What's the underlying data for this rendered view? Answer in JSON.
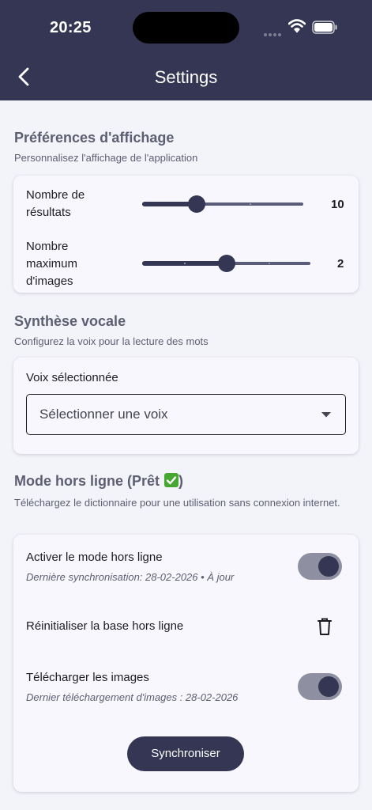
{
  "status_bar": {
    "time": "20:25"
  },
  "header": {
    "title": "Settings"
  },
  "display": {
    "title": "Préférences d'affichage",
    "subtitle": "Personnalisez l'affichage de l'application",
    "results": {
      "label": "Nombre de\nrésultats",
      "value": "10",
      "position": 0.34
    },
    "images": {
      "label": "Nombre\nmaximum\nd'images",
      "value": "2",
      "position": 0.5
    }
  },
  "voice": {
    "title": "Synthèse vocale",
    "subtitle": "Configurez la voix pour la lecture des mots",
    "selected_label": "Voix sélectionnée",
    "select_value": "Sélectionner une voix"
  },
  "offline": {
    "title": "Mode hors ligne (Prêt ",
    "title_end": ")",
    "subtitle": "Téléchargez le dictionnaire pour une utilisation sans connexion internet.",
    "activate": {
      "label": "Activer le mode hors ligne",
      "sub": "Dernière synchronisation: 28-02-2026 • À jour",
      "on": true
    },
    "reset": {
      "label": "Réinitialiser la base hors ligne"
    },
    "images": {
      "label": "Télécharger les images",
      "sub": "Dernier téléchargement d'images : 28-02-2026",
      "on": true
    },
    "sync_label": "Synchroniser"
  },
  "colors": {
    "primary": "#343653",
    "background": "#f3f3fa",
    "card": "#f7f7fd",
    "check": "#46a832"
  }
}
